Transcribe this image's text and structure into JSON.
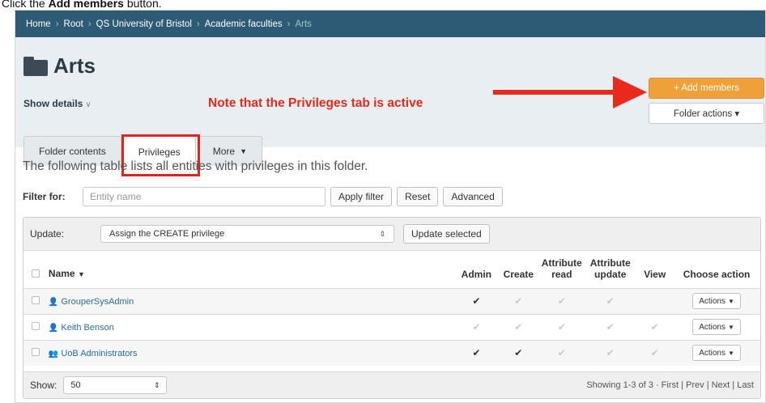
{
  "instruction": {
    "prefix": "Click the ",
    "bold": "Add members",
    "suffix": " button."
  },
  "breadcrumb": [
    "Home",
    "Root",
    "QS University of Bristol",
    "Academic faculties"
  ],
  "breadcrumb_current": "Arts",
  "page_title": "Arts",
  "show_details": "Show details",
  "note": "Note that the Privileges tab is active",
  "buttons": {
    "add_members": "+ Add members",
    "folder_actions": "Folder actions ▾"
  },
  "tabs": [
    {
      "label": "Folder contents",
      "active": false
    },
    {
      "label": "Privileges",
      "active": true
    },
    {
      "label": "More",
      "active": false
    }
  ],
  "intro": "The following table lists all entities with privileges in this folder.",
  "filter": {
    "label": "Filter for:",
    "placeholder": "Entity name",
    "apply": "Apply filter",
    "reset": "Reset",
    "advanced": "Advanced"
  },
  "update": {
    "label": "Update:",
    "selected": "Assign the CREATE privilege",
    "button": "Update selected"
  },
  "table": {
    "headers": {
      "name": "Name",
      "admin": "Admin",
      "create": "Create",
      "attr_read": [
        "Attribute",
        "read"
      ],
      "attr_update": [
        "Attribute",
        "update"
      ],
      "view": "View",
      "choose": "Choose action"
    },
    "rows": [
      {
        "name": "GrouperSysAdmin",
        "icon": "user-icon",
        "admin": true,
        "create": false,
        "attr_read": false,
        "attr_update": false,
        "view": null,
        "action": "Actions"
      },
      {
        "name": "Keith Benson",
        "icon": "user-icon",
        "admin": false,
        "create": false,
        "attr_read": false,
        "attr_update": false,
        "view": false,
        "action": "Actions"
      },
      {
        "name": "UoB Administrators",
        "icon": "group-icon",
        "admin": true,
        "create": true,
        "attr_read": false,
        "attr_update": false,
        "view": false,
        "action": "Actions"
      }
    ]
  },
  "footer": {
    "show_label": "Show:",
    "show_value": "50",
    "pager": "Showing 1-3 of 3 · First | Prev | Next | Last"
  },
  "colors": {
    "accent_orange": "#f0a038",
    "breadcrumb_bg": "#2d5b75",
    "note_red": "#e8291c",
    "link_blue": "#2a6e9e"
  }
}
